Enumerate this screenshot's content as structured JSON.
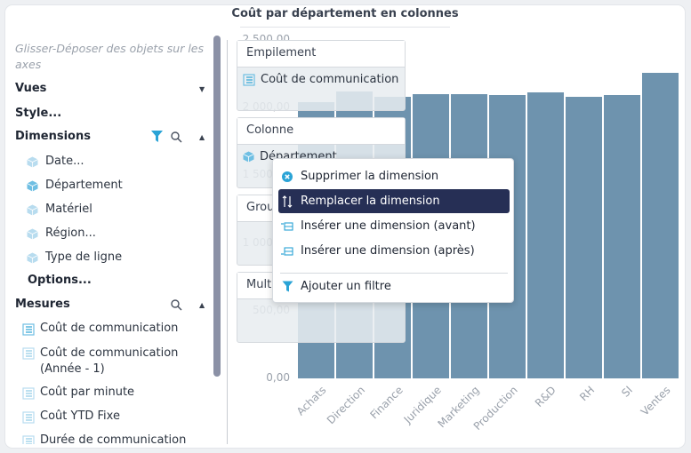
{
  "title": "Coût par département en colonnes",
  "panel": {
    "hint": "Glisser-Déposer des objets sur les axes",
    "vues": "Vues",
    "style": "Style...",
    "dimensions_label": "Dimensions",
    "dimensions": [
      "Date...",
      "Département",
      "Matériel",
      "Région...",
      "Type de ligne"
    ],
    "options": "Options...",
    "mesures_label": "Mesures",
    "mesures": [
      "Coût de communication",
      "Coût de communication (Année - 1)",
      "Coût par minute",
      "Coût YTD Fixe",
      "Durée de communication"
    ]
  },
  "axes": {
    "empilement": "Empilement",
    "empilement_item": "Coût de communication",
    "colonne": "Colonne",
    "colonne_item": "Département",
    "groupe": "Grou",
    "multi": "Multi"
  },
  "menu": {
    "items": [
      "Supprimer la dimension",
      "Remplacer la dimension",
      "Insérer une dimension (avant)",
      "Insérer une dimension (après)",
      "Ajouter un filtre"
    ]
  },
  "colors": {
    "bar": "#6e93ae",
    "accent": "#262f55",
    "icon": "#2aa3d6"
  },
  "chart_data": {
    "type": "bar",
    "categories": [
      "Achats",
      "Direction",
      "Finance",
      "Juridique",
      "Marketing",
      "Production",
      "R&D",
      "RH",
      "SI",
      "Ventes"
    ],
    "values": [
      2040,
      2120,
      2080,
      2100,
      2100,
      2090,
      2110,
      2080,
      2090,
      2260
    ],
    "ylim": [
      0,
      2500
    ],
    "yticks": [
      "0,00",
      "500,00",
      "1 000,00",
      "1 500,00",
      "2 000,00",
      "2 500,00"
    ]
  }
}
